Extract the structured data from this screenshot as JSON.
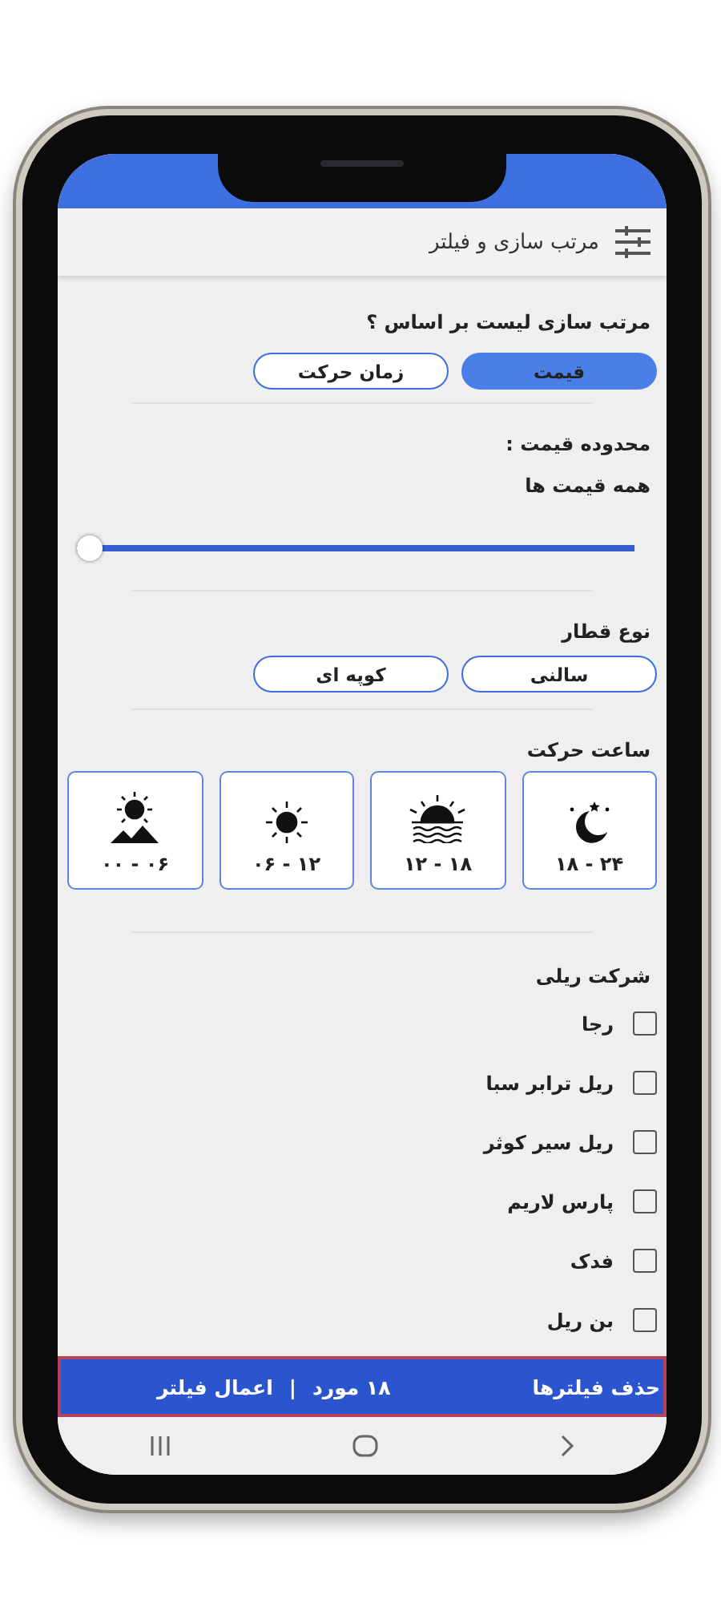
{
  "header": {
    "title": "مرتب سازی و فیلتر"
  },
  "sort": {
    "label": "مرتب سازی لیست بر اساس ؟",
    "options": [
      {
        "label": "قیمت",
        "selected": true
      },
      {
        "label": "زمان حرکت",
        "selected": false
      }
    ]
  },
  "price": {
    "label": "محدوده قیمت :",
    "value_text": "همه قیمت ها",
    "slider": {
      "level": 1
    }
  },
  "train_type": {
    "label": "نوع قطار",
    "options": [
      {
        "label": "سالنی",
        "selected": false
      },
      {
        "label": "کوپه ای",
        "selected": false
      }
    ]
  },
  "departure_time": {
    "label": "ساعت حرکت",
    "slots": [
      {
        "label": "۱۸ - ۲۴",
        "selected": false
      },
      {
        "label": "۱۲ - ۱۸",
        "selected": false
      },
      {
        "label": "۰۶ - ۱۲",
        "selected": false
      },
      {
        "label": "۰۰ - ۰۶",
        "selected": false
      }
    ]
  },
  "company": {
    "label": "شرکت ریلی",
    "items": [
      {
        "label": "رجا",
        "checked": false
      },
      {
        "label": "ریل ترابر سبا",
        "checked": false
      },
      {
        "label": "ریل سیر کوثر",
        "checked": false
      },
      {
        "label": "پارس لاریم",
        "checked": false
      },
      {
        "label": "فدک",
        "checked": false
      },
      {
        "label": "بن ریل",
        "checked": false
      }
    ]
  },
  "bottom_bar": {
    "clear_label": "حذف فیلترها",
    "count": "۱۸ مورد",
    "separator": "|",
    "apply_label": "اعمال فیلتر"
  }
}
